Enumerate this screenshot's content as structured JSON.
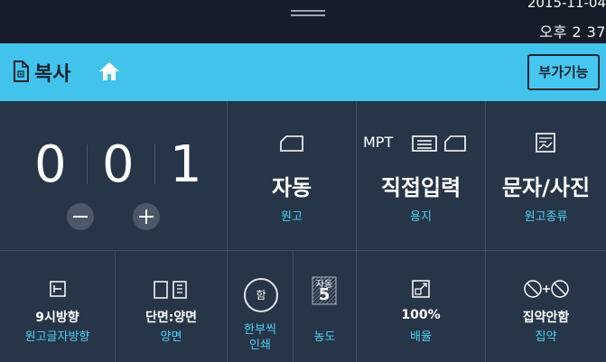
{
  "status": {
    "date": "2015-11-04",
    "time": "오후 2 37"
  },
  "title": {
    "text": "복사",
    "extra_button": "부가기능"
  },
  "copies": {
    "digits": [
      "0",
      "0",
      "1"
    ]
  },
  "top_cells": [
    {
      "main": "자동",
      "sub": "원고"
    },
    {
      "prefix": "MPT",
      "main": "직접입력",
      "sub": "용지"
    },
    {
      "main": "문자/사진",
      "sub": "원고종류"
    }
  ],
  "bottom_cells": [
    {
      "main": "9시방향",
      "sub": "원고글자방향"
    },
    {
      "main": "단면:양면",
      "sub": "양면"
    },
    {
      "circle": "함",
      "sub1": "한부씩",
      "sub2": "인쇄"
    },
    {
      "badge": "자동",
      "badge_num": "5",
      "sub": "농도"
    },
    {
      "main": "100%",
      "sub": "배율"
    },
    {
      "main": "집약안함",
      "sub": "집약"
    }
  ],
  "colors": {
    "accent": "#41c3ec",
    "panel": "#263547",
    "sublabel": "#4fd0f4"
  }
}
